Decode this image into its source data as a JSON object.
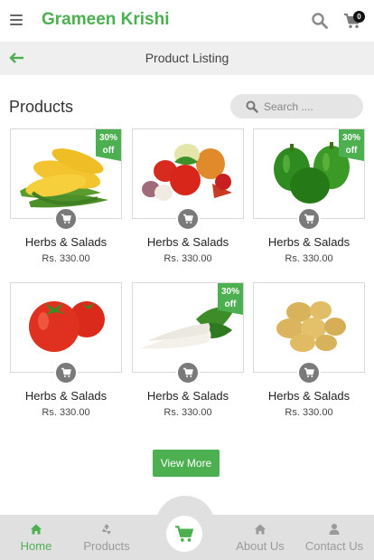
{
  "header": {
    "app_title": "Grameen Krishi",
    "cart_count": "0"
  },
  "subheader": {
    "title": "Product Listing"
  },
  "products_section": {
    "title": "Products",
    "search_placeholder": "Search ...."
  },
  "products": [
    {
      "name": "Herbs & Salads",
      "price": "Rs. 330.00",
      "badge": [
        "30%",
        "off"
      ],
      "image": "corn"
    },
    {
      "name": "Herbs & Salads",
      "price": "Rs. 330.00",
      "badge": null,
      "image": "mixed-vegetables"
    },
    {
      "name": "Herbs & Salads",
      "price": "Rs. 330.00",
      "badge": [
        "30%",
        "off"
      ],
      "image": "green-capsicum"
    },
    {
      "name": "Herbs & Salads",
      "price": "Rs. 330.00",
      "badge": null,
      "image": "tomatoes"
    },
    {
      "name": "Herbs & Salads",
      "price": "Rs. 330.00",
      "badge": [
        "30%",
        "off"
      ],
      "image": "radish"
    },
    {
      "name": "Herbs & Salads",
      "price": "Rs. 330.00",
      "badge": null,
      "image": "potatoes"
    }
  ],
  "view_more_label": "View More",
  "bottom_nav": {
    "items": [
      {
        "label": "Home",
        "icon": "home-icon",
        "active": true
      },
      {
        "label": "Products",
        "icon": "recycle-icon",
        "active": false
      },
      {
        "label": "About Us",
        "icon": "home-icon",
        "active": false
      },
      {
        "label": "Contact Us",
        "icon": "person-icon",
        "active": false
      }
    ],
    "center_icon": "cart-icon"
  },
  "colors": {
    "accent": "#4caf50",
    "nav_bg": "#e0e0e0",
    "subbar_bg": "#efefef",
    "inactive": "#9a9a9a"
  }
}
